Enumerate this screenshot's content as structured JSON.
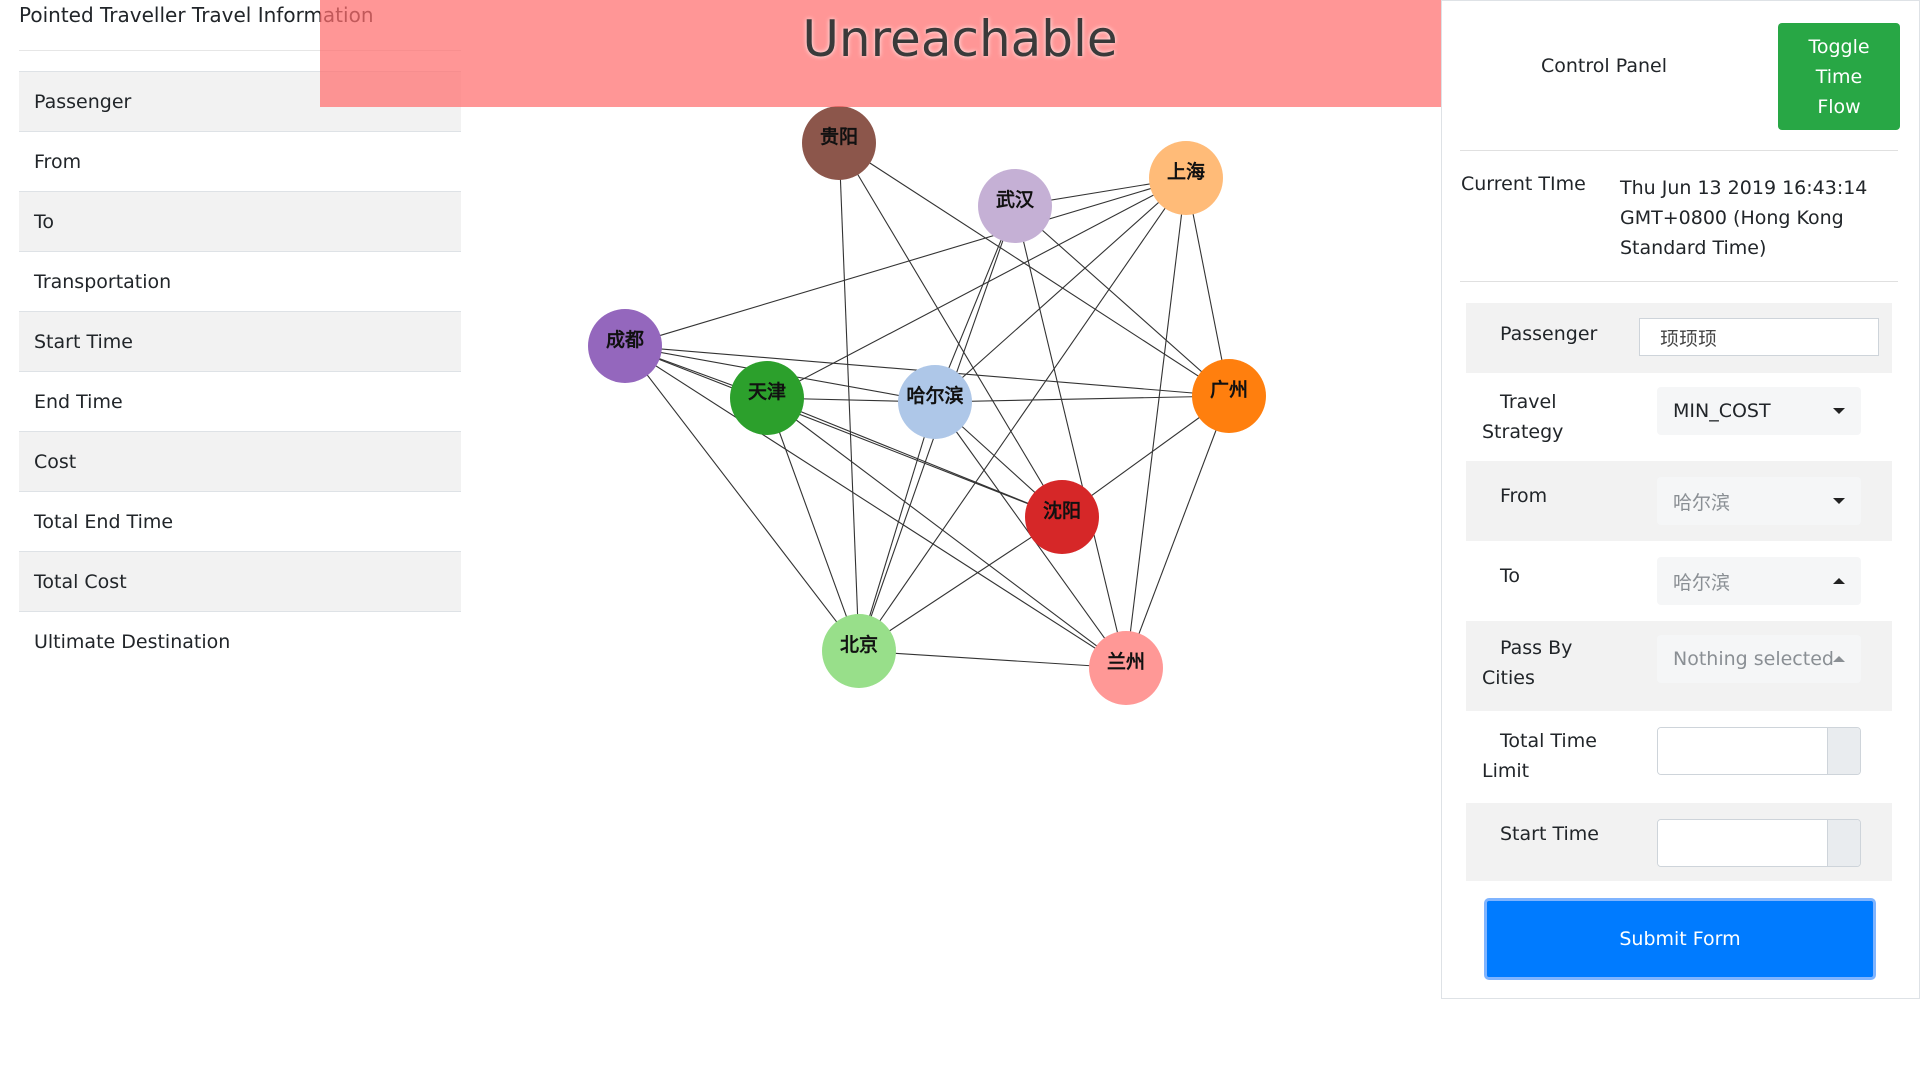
{
  "left_panel": {
    "title": "Pointed Traveller Travel Information",
    "rows": [
      {
        "label": "Passenger"
      },
      {
        "label": "From"
      },
      {
        "label": "To"
      },
      {
        "label": "Transportation"
      },
      {
        "label": "Start Time"
      },
      {
        "label": "End Time"
      },
      {
        "label": "Cost"
      },
      {
        "label": "Total End Time"
      },
      {
        "label": "Total Cost"
      },
      {
        "label": "Ultimate Destination"
      }
    ]
  },
  "banner": {
    "text": "Unreachable",
    "color": "#ff8a8a"
  },
  "graph": {
    "nodes": [
      {
        "id": "guiyang",
        "label": "贵阳",
        "color": "#8c564b"
      },
      {
        "id": "wuhan",
        "label": "武汉",
        "color": "#c5b0d5"
      },
      {
        "id": "shanghai",
        "label": "上海",
        "color": "#ffbb78"
      },
      {
        "id": "chengdu",
        "label": "成都",
        "color": "#9467bd"
      },
      {
        "id": "tianjin",
        "label": "天津",
        "color": "#2ca02c"
      },
      {
        "id": "haerbin",
        "label": "哈尔滨",
        "color": "#aec7e8"
      },
      {
        "id": "guangzhou",
        "label": "广州",
        "color": "#ff7f0e"
      },
      {
        "id": "shenyang",
        "label": "沈阳",
        "color": "#d62728"
      },
      {
        "id": "beijing",
        "label": "北京",
        "color": "#98df8a"
      },
      {
        "id": "lanzhou",
        "label": "兰州",
        "color": "#ff9896"
      }
    ],
    "edges": [
      [
        "guiyang",
        "beijing"
      ],
      [
        "guiyang",
        "shenyang"
      ],
      [
        "guiyang",
        "guangzhou"
      ],
      [
        "wuhan",
        "shanghai"
      ],
      [
        "wuhan",
        "beijing"
      ],
      [
        "wuhan",
        "haerbin"
      ],
      [
        "wuhan",
        "guangzhou"
      ],
      [
        "wuhan",
        "lanzhou"
      ],
      [
        "shanghai",
        "chengdu"
      ],
      [
        "shanghai",
        "tianjin"
      ],
      [
        "shanghai",
        "haerbin"
      ],
      [
        "shanghai",
        "beijing"
      ],
      [
        "shanghai",
        "guangzhou"
      ],
      [
        "shanghai",
        "lanzhou"
      ],
      [
        "chengdu",
        "tianjin"
      ],
      [
        "chengdu",
        "haerbin"
      ],
      [
        "chengdu",
        "guangzhou"
      ],
      [
        "chengdu",
        "shenyang"
      ],
      [
        "chengdu",
        "beijing"
      ],
      [
        "chengdu",
        "lanzhou"
      ],
      [
        "tianjin",
        "haerbin"
      ],
      [
        "tianjin",
        "shenyang"
      ],
      [
        "tianjin",
        "beijing"
      ],
      [
        "tianjin",
        "lanzhou"
      ],
      [
        "haerbin",
        "guangzhou"
      ],
      [
        "haerbin",
        "shenyang"
      ],
      [
        "haerbin",
        "beijing"
      ],
      [
        "haerbin",
        "lanzhou"
      ],
      [
        "guangzhou",
        "shenyang"
      ],
      [
        "guangzhou",
        "lanzhou"
      ],
      [
        "shenyang",
        "beijing"
      ],
      [
        "beijing",
        "lanzhou"
      ]
    ]
  },
  "control_panel": {
    "title": "Control Panel",
    "toggle_button": [
      "Toggle",
      "Time",
      "Flow"
    ],
    "current_time_label": "Current TIme",
    "current_time_value": [
      "Thu Jun 13 2019 16:43:14",
      "GMT+0800 (Hong Kong",
      "Standard Time)"
    ],
    "passenger": {
      "label": "Passenger",
      "value": "顼顼顼"
    },
    "travel_strategy": {
      "label": [
        "Travel",
        "Strategy"
      ],
      "value": "MIN_COST"
    },
    "from": {
      "label": "From",
      "value": "哈尔滨"
    },
    "to": {
      "label": "To",
      "value": "哈尔滨"
    },
    "pass_by": {
      "label": [
        "Pass By",
        "Cities"
      ],
      "placeholder": "Nothing selected"
    },
    "total_time_limit": {
      "label": [
        "Total Time",
        "Limit"
      ],
      "value": ""
    },
    "start_time": {
      "label": "Start Time",
      "value": ""
    },
    "submit_label": "Submit Form",
    "colors": {
      "toggle": "#28a745",
      "submit": "#007bff"
    }
  }
}
